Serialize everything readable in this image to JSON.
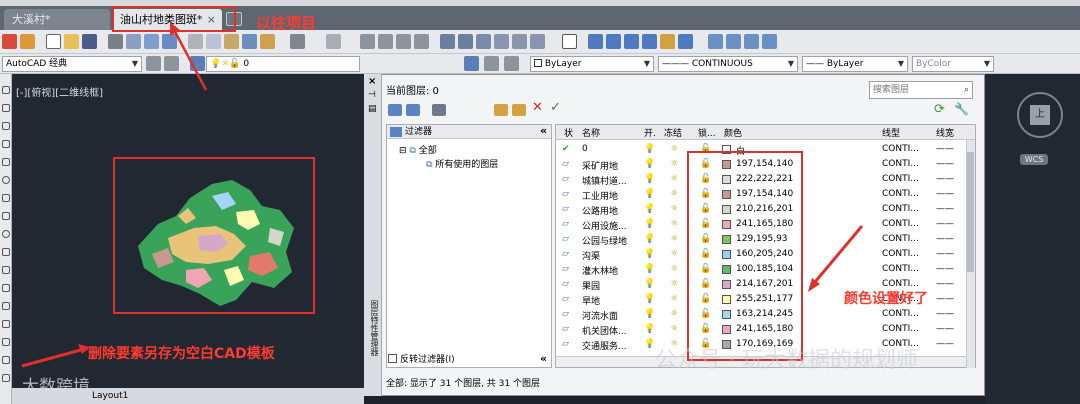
{
  "tabs": [
    {
      "label": "大溪村*"
    },
    {
      "label": "油山村地类图斑*",
      "close": "×"
    }
  ],
  "workspace": {
    "value": "AutoCAD 经典"
  },
  "layer_bar": {
    "current": "0"
  },
  "props": {
    "color": "ByLayer",
    "linetype": "CONTINUOUS",
    "lineweight": "ByLayer",
    "plotstyle": "ByColor"
  },
  "viewport_label": "[-][俯视][二维线框]",
  "layout_tab": "Layout1",
  "palette": {
    "current_layer": "当前图层: 0",
    "search_placeholder": "搜索图层",
    "filter_header": "过滤器",
    "collapse": "«",
    "tree_all": "全部",
    "tree_used": "所有使用的图层",
    "invert_filter": "反转过滤器(I)",
    "status": "全部: 显示了 31 个图层, 共 31 个图层",
    "vertical_title": "图层特性管理器"
  },
  "table": {
    "headers": {
      "status": "状",
      "name": "名称",
      "on": "开.",
      "freeze": "冻结",
      "lock": "锁...",
      "color": "颜色",
      "linetype": "线型",
      "lineweight": "线宽"
    },
    "rows": [
      {
        "name": "0",
        "color": "白",
        "swatch": "#ffffff",
        "linetype": "CONTI...",
        "current": true
      },
      {
        "name": "采矿用地",
        "color": "197,154,140",
        "swatch": "#c59a8c",
        "linetype": "CONTI..."
      },
      {
        "name": "城镇村道...",
        "color": "222,222,221",
        "swatch": "#dededd",
        "linetype": "CONTI..."
      },
      {
        "name": "工业用地",
        "color": "197,154,140",
        "swatch": "#c59a8c",
        "linetype": "CONTI..."
      },
      {
        "name": "公路用地",
        "color": "210,216,201",
        "swatch": "#d2d8c9",
        "linetype": "CONTI..."
      },
      {
        "name": "公用设施...",
        "color": "241,165,180",
        "swatch": "#f1a5b4",
        "linetype": "CONTI..."
      },
      {
        "name": "公园与绿地",
        "color": "129,195,93",
        "swatch": "#81c35d",
        "linetype": "CONTI..."
      },
      {
        "name": "沟渠",
        "color": "160,205,240",
        "swatch": "#a0cdf0",
        "linetype": "CONTI..."
      },
      {
        "name": "灌木林地",
        "color": "100,185,104",
        "swatch": "#64b968",
        "linetype": "CONTI..."
      },
      {
        "name": "果园",
        "color": "214,167,201",
        "swatch": "#d6a7c9",
        "linetype": "CONTI..."
      },
      {
        "name": "旱地",
        "color": "255,251,177",
        "swatch": "#fffbb1",
        "linetype": "CONTI..."
      },
      {
        "name": "河流水面",
        "color": "163,214,245",
        "swatch": "#a3d6f5",
        "linetype": "CONTI..."
      },
      {
        "name": "机关团体...",
        "color": "241,165,180",
        "swatch": "#f1a5b4",
        "linetype": "CONTI..."
      },
      {
        "name": "交通服务...",
        "color": "170,169,169",
        "swatch": "#aaa9a9",
        "linetype": "CONTI..."
      }
    ]
  },
  "nav": {
    "face": "上",
    "wcs": "WCS"
  },
  "annotations": {
    "top": "以往项目",
    "delete": "删除要素另存为空白CAD模板",
    "colors": "颜色设置好了"
  },
  "watermarks": {
    "left": "大数跨境",
    "right": "公众号 · 玩大数据的规划师"
  },
  "colors": {
    "annotation_red": "#e0302a",
    "canvas_bg": "#222831"
  }
}
